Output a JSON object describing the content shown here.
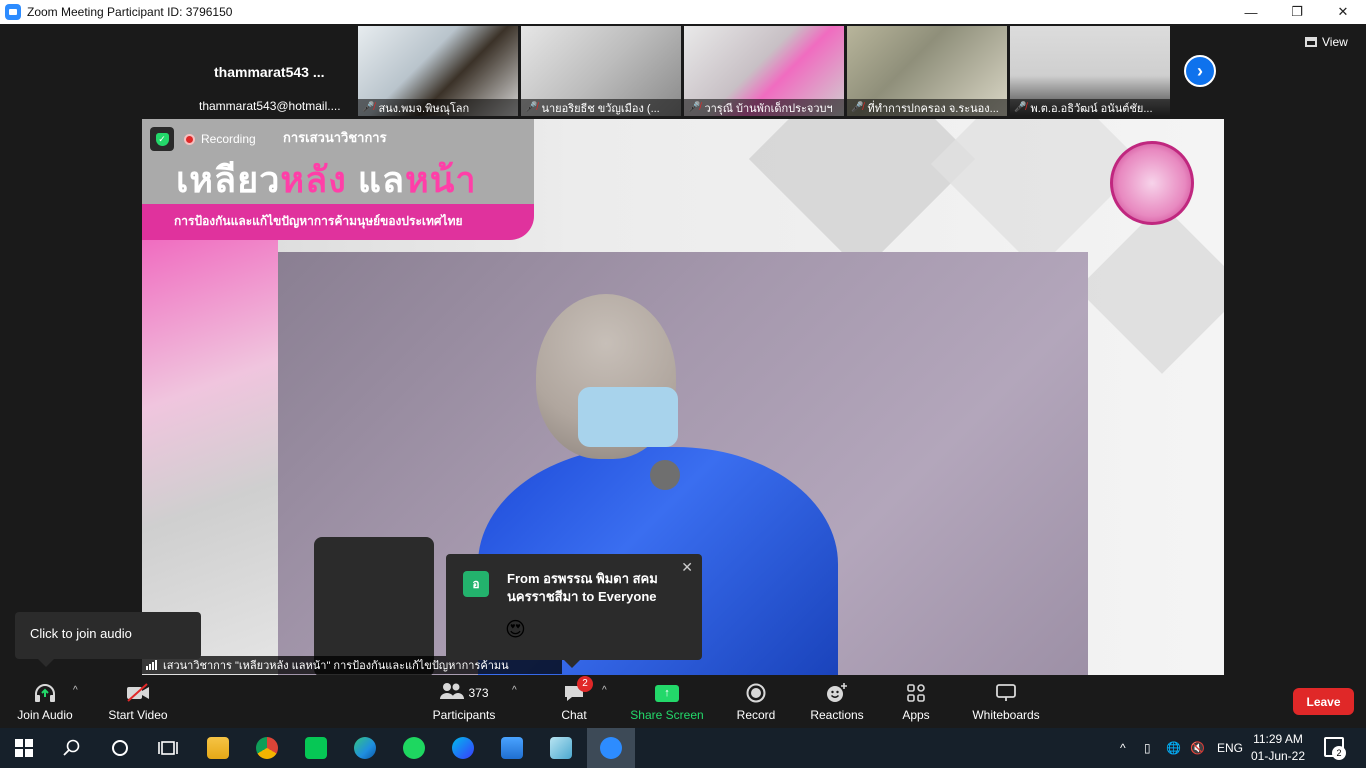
{
  "window": {
    "title": "Zoom Meeting Participant ID: 3796150",
    "minimize": "—",
    "maximize": "❐",
    "close": "✕"
  },
  "self_tile": {
    "name": "thammarat543 ...",
    "email": "thammarat543@hotmail...."
  },
  "participants": [
    {
      "label": "สนง.พมจ.พิษณุโลก"
    },
    {
      "label": "นายอริยธีช  ขวัญเมือง  (..."
    },
    {
      "label": "วารุณี บ้านพักเด็กประจวบฯ"
    },
    {
      "label": "ที่ทำการปกครอง จ.ระนอง..."
    },
    {
      "label": "พ.ต.อ.อธิวัฒน์ อนันต์ชัย..."
    }
  ],
  "view": {
    "label": "View"
  },
  "share": {
    "recording_label": "Recording",
    "banner_small": "การเสวนาวิชาการ",
    "banner_title_a": "เหลียว",
    "banner_title_b": "หลัง",
    "banner_title_c": " แล",
    "banner_title_d": "หน้า",
    "banner_subtitle": "การป้องกันและแก้ไขปัญหาการค้ามนุษย์ของประเทศไทย",
    "ticker": "เสวนาวิชาการ \"เหลียวหลัง แลหน้า\" การป้องกันและแก้ไขปัญหาการค้ามน"
  },
  "tooltip": {
    "text": "Click to join audio"
  },
  "chat_popup": {
    "avatar": "อ",
    "from": "From อรพรรณ พิมดา สคม นครราชสีมา to Everyone",
    "emoji": "😍",
    "close": "✕"
  },
  "toolbar": {
    "join_audio": "Join Audio",
    "start_video": "Start Video",
    "participants_label": "Participants",
    "participants_count": "373",
    "chat": "Chat",
    "chat_badge": "2",
    "share_screen": "Share Screen",
    "record": "Record",
    "reactions": "Reactions",
    "apps": "Apps",
    "whiteboards": "Whiteboards",
    "leave": "Leave"
  },
  "taskbar": {
    "lang": "ENG",
    "time": "11:29 AM",
    "date": "01-Jun-22",
    "notification_count": "2"
  },
  "colors": {
    "zoom_blue": "#2d8cff",
    "share_green": "#23d86a",
    "leave_red": "#e02828",
    "banner_pink": "#e0329d"
  }
}
